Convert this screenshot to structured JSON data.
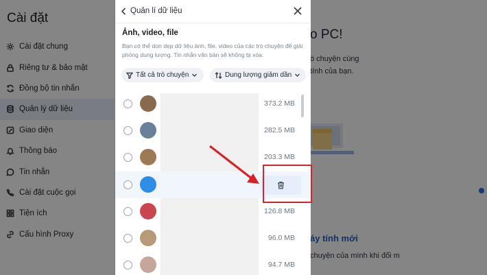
{
  "sidebar": {
    "title": "Cài đặt",
    "items": [
      {
        "label": "Cài đặt chung",
        "icon": "gear-icon"
      },
      {
        "label": "Riêng tư & bảo mật",
        "icon": "lock-icon"
      },
      {
        "label": "Đồng bộ tin nhắn",
        "icon": "sync-icon"
      },
      {
        "label": "Quản lý dữ liệu",
        "icon": "database-icon",
        "active": true
      },
      {
        "label": "Giao diện",
        "icon": "palette-icon"
      },
      {
        "label": "Thông báo",
        "icon": "bell-icon"
      },
      {
        "label": "Tin nhắn",
        "icon": "chat-icon"
      },
      {
        "label": "Cài đặt cuộc gọi",
        "icon": "phone-icon"
      },
      {
        "label": "Tiện ích",
        "icon": "grid-icon"
      },
      {
        "label": "Cấu hình Proxy",
        "icon": "proxy-icon"
      }
    ]
  },
  "panel": {
    "back_label": "Quản lí dữ liệu",
    "section_title": "Ảnh, video, file",
    "description": "Bạn có thể dọn dẹp dữ liệu ảnh, file, video của các trò chuyện để giải phóng dung lượng. Tin nhắn văn bản sẽ không bị xóa.",
    "filter_conversations": "Tất cả trò chuyện",
    "filter_sort": "Dung lượng giảm dần",
    "rows": [
      {
        "size": "373.2 MB",
        "avatar_color": "#8a6a4f"
      },
      {
        "size": "282.5 MB",
        "avatar_color": "#6a7f9a"
      },
      {
        "size": "203.3 MB",
        "avatar_color": "#9d7a55"
      },
      {
        "size": "",
        "avatar_color": "#2f8de6",
        "hovered": true
      },
      {
        "size": "126.8 MB",
        "avatar_color": "#c9464e"
      },
      {
        "size": "96.0 MB",
        "avatar_color": "#b79a78"
      },
      {
        "size": "94.7 MB",
        "avatar_color": "#c4a79a"
      }
    ]
  },
  "background": {
    "title": "o PC!",
    "line1": "ò chuyện cùng",
    "line2": "tính của bạn.",
    "feature_title": "áy tính mới",
    "feature_line": "chuyện của mình khi đổi m"
  },
  "colors": {
    "accent": "#1c5fc7",
    "highlight": "#d6222a",
    "active_nav": "#e9f0fb"
  }
}
